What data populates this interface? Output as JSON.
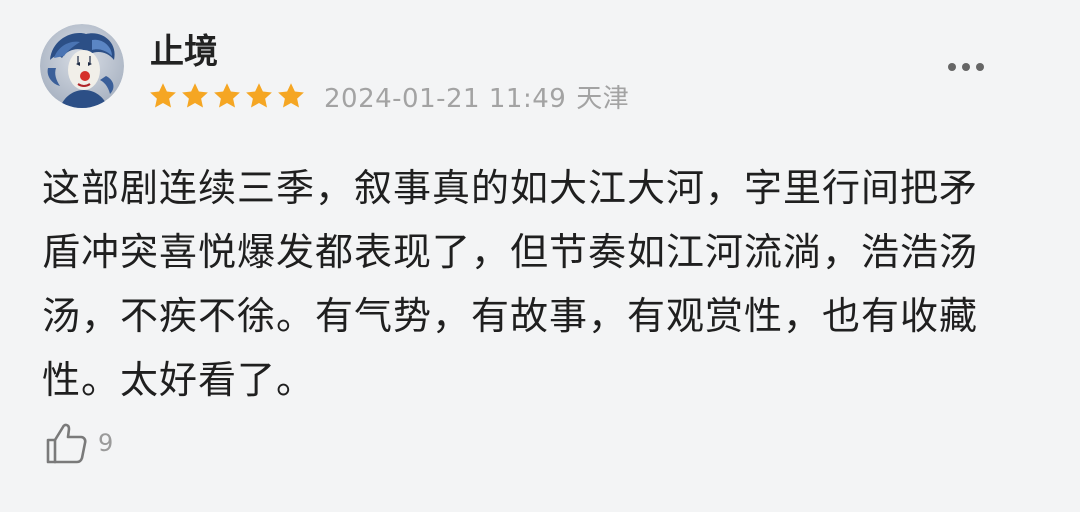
{
  "review": {
    "username": "止境",
    "rating": 5,
    "rating_max": 5,
    "date": "2024-01-21 11:49",
    "location": "天津",
    "text": "这部剧连续三季，叙事真的如大江大河，字里行间把矛盾冲突喜悦爆发都表现了，但节奏如江河流淌，浩浩汤汤，不疾不徐。有气势，有故事，有观赏性，也有收藏性。太好看了。",
    "like_count": "9"
  },
  "colors": {
    "star": "#f5a623",
    "meta_text": "#a3a3a3",
    "background": "#f3f4f5"
  },
  "icons": {
    "more": "more-dots-icon",
    "like": "thumbs-up-icon",
    "star": "star-icon"
  }
}
